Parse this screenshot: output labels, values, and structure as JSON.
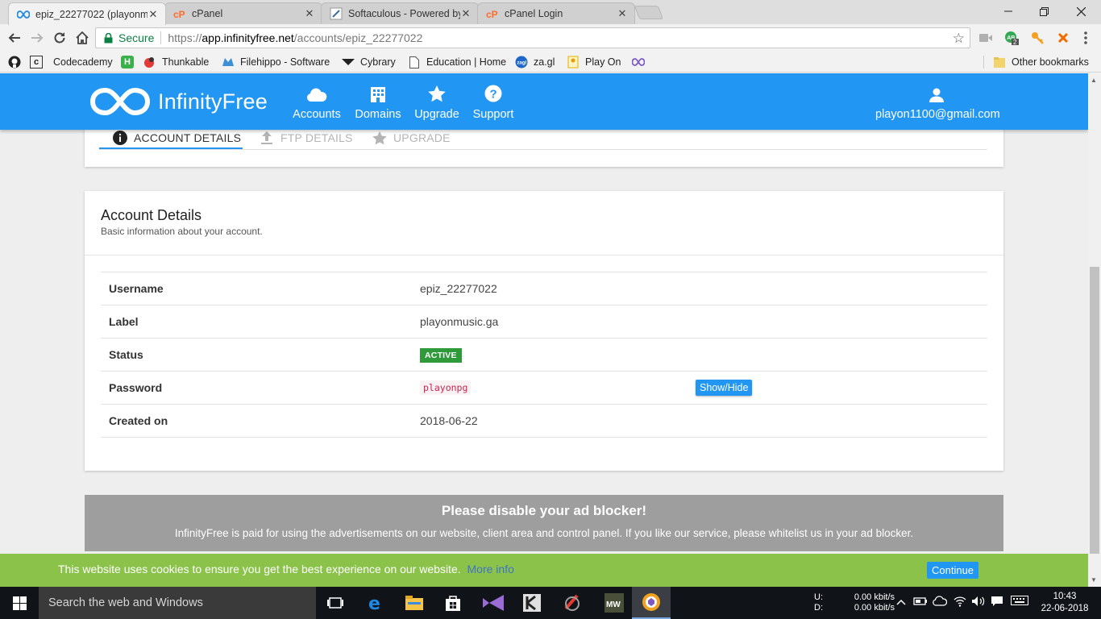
{
  "browser": {
    "tabs": [
      {
        "title": "epiz_22277022 (playonm",
        "icon": "infinity-icon",
        "active": true
      },
      {
        "title": "cPanel",
        "icon": "cpanel-icon",
        "active": false
      },
      {
        "title": "Softaculous - Powered by",
        "icon": "softaculous-icon",
        "active": false
      },
      {
        "title": "cPanel Login",
        "icon": "cpanel-icon",
        "active": false
      }
    ],
    "address": {
      "secure_label": "Secure",
      "scheme": "https://",
      "host": "app.infinityfree.net",
      "path": "/accounts/epiz_22277022"
    },
    "extension_badge": "2",
    "bookmarks": [
      {
        "label": "",
        "icon": "github-icon"
      },
      {
        "label": "",
        "icon": "codecademy-c-icon"
      },
      {
        "label": "Codecademy",
        "icon": "codecademy-icon"
      },
      {
        "label": "",
        "icon": "h-icon"
      },
      {
        "label": "Thunkable",
        "icon": "thunkable-icon"
      },
      {
        "label": "Filehippo - Software",
        "icon": "filehippo-icon"
      },
      {
        "label": "Cybrary",
        "icon": "cybrary-icon"
      },
      {
        "label": "Education | Home",
        "icon": "page-icon"
      },
      {
        "label": "za.gl",
        "icon": "zagl-icon"
      },
      {
        "label": "Play On",
        "icon": "playon-icon"
      },
      {
        "label": "",
        "icon": "infinity-icon"
      }
    ],
    "other_bookmarks": "Other bookmarks"
  },
  "site": {
    "brand": "InfinityFree",
    "nav": [
      {
        "label": "Accounts",
        "icon": "cloud-icon"
      },
      {
        "label": "Domains",
        "icon": "building-icon"
      },
      {
        "label": "Upgrade",
        "icon": "star-icon"
      },
      {
        "label": "Support",
        "icon": "help-icon"
      }
    ],
    "user_email": "playon1100@gmail.com",
    "colors": {
      "primary": "#2196f3",
      "active_badge": "#2e9a3a",
      "cookie_bar": "#8bc34a",
      "adblock": "#9e9e9e"
    }
  },
  "account_tabs": [
    {
      "label": "ACCOUNT DETAILS",
      "icon": "info-icon"
    },
    {
      "label": "FTP DETAILS",
      "icon": "upload-icon"
    },
    {
      "label": "UPGRADE",
      "icon": "star-icon"
    }
  ],
  "details": {
    "title": "Account Details",
    "subtitle": "Basic information about your account.",
    "rows": {
      "username": {
        "label": "Username",
        "value": "epiz_22277022"
      },
      "label": {
        "label": "Label",
        "value": "playonmusic.ga"
      },
      "status": {
        "label": "Status",
        "value": "ACTIVE"
      },
      "password": {
        "label": "Password",
        "value": "playonpg",
        "button": "Show/Hide"
      },
      "created": {
        "label": "Created on",
        "value": "2018-06-22"
      }
    }
  },
  "adblock": {
    "title": "Please disable your ad blocker!",
    "text": "InfinityFree is paid for using the advertisements on our website, client area and control panel. If you like our service, please whitelist us in your ad blocker."
  },
  "cookie": {
    "text": "This website uses cookies to ensure you get the best experience on our website.",
    "more": "More info",
    "button": "Continue"
  },
  "taskbar": {
    "search_placeholder": "Search the web and Windows",
    "net_up_label": "U:",
    "net_down_label": "D:",
    "net_up": "0.00 kbit/s",
    "net_down": "0.00 kbit/s",
    "time": "10:43",
    "date": "22-06-2018"
  }
}
